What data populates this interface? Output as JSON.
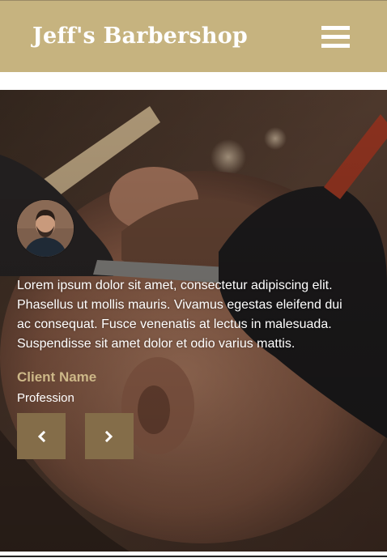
{
  "header": {
    "brand": "Jeff's Barbershop",
    "menu_icon": "hamburger-menu-icon",
    "background_color": "#c6b37f"
  },
  "testimonial": {
    "quote": "Lorem ipsum dolor sit amet, consectetur adipiscing elit. Phasellus ut mollis mauris. Vivamus egestas eleifend dui ac consequat. Fusce venenatis at lectus in malesuada. Suspendisse sit amet dolor et odio varius mattis.",
    "client_name": "Client Name",
    "profession": "Profession",
    "accent_color": "#cdb888",
    "prev_icon": "chevron-left-icon",
    "next_icon": "chevron-right-icon",
    "button_color": "#846d49"
  }
}
